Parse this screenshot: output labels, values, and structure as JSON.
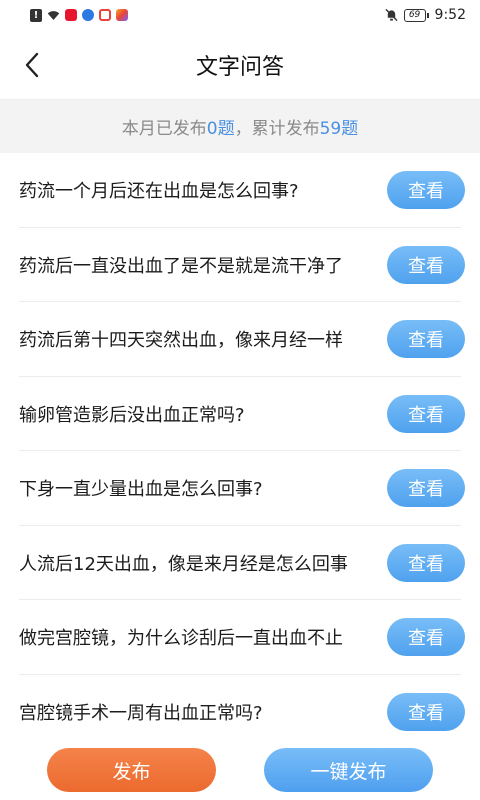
{
  "status_bar": {
    "time": "9:52",
    "battery": "69",
    "alert_glyph": "!",
    "icons": [
      "alert-icon",
      "wifi-icon",
      "weibo-icon",
      "app-blue-icon",
      "app-red-icon",
      "app-multicolor-icon"
    ],
    "right_icons": [
      "bell-muted-icon",
      "battery-icon"
    ],
    "colors": {
      "weibo": "#e6162d",
      "app_blue": "#2a7ae2",
      "app_red": "#e8443a",
      "app_multi": "#f5a623"
    }
  },
  "nav": {
    "title": "文字问答",
    "back_icon": "chevron-left-icon"
  },
  "summary": {
    "prefix": "本月已发布",
    "month_count": "0题",
    "middle": "，累计发布",
    "total_count": "59题"
  },
  "questions": [
    {
      "text": "药流一个月后还在出血是怎么回事?",
      "button": "查看"
    },
    {
      "text": "药流后一直没出血了是不是就是流干净了",
      "button": "查看"
    },
    {
      "text": "药流后第十四天突然出血，像来月经一样",
      "button": "查看"
    },
    {
      "text": "输卵管造影后没出血正常吗?",
      "button": "查看"
    },
    {
      "text": "下身一直少量出血是怎么回事?",
      "button": "查看"
    },
    {
      "text": "人流后12天出血，像是来月经是怎么回事",
      "button": "查看"
    },
    {
      "text": "做完宫腔镜，为什么诊刮后一直出血不止",
      "button": "查看"
    },
    {
      "text": "宫腔镜手术一周有出血正常吗?",
      "button": "查看"
    }
  ],
  "bottom": {
    "publish": "发布",
    "one_click_publish": "一键发布"
  },
  "colors": {
    "accent_blue": "#4a90e2",
    "accent_orange": "#ec6a2e"
  }
}
